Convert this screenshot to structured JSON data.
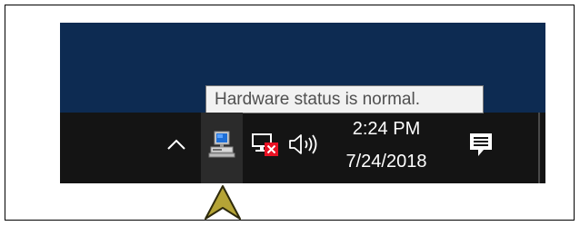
{
  "tooltip": {
    "text": "Hardware status is normal."
  },
  "clock": {
    "time": "2:24 PM",
    "date": "7/24/2018"
  },
  "tray": {
    "icons": [
      "chevron-up-icon",
      "hardware-status-icon",
      "network-disconnected-icon",
      "volume-icon",
      "action-center-icon"
    ]
  },
  "colors": {
    "desktop_background": "#0d2b52",
    "taskbar": "#141414",
    "tooltip_background": "#f2f2f2",
    "pointer_fill": "#b5a436",
    "error_badge": "#e81123"
  }
}
